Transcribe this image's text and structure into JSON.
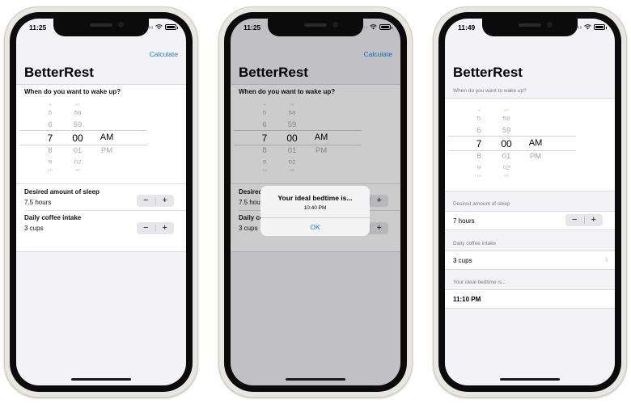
{
  "phones": [
    {
      "status_time": "11:25",
      "nav_button": "Calculate",
      "title": "BetterRest",
      "wake_question": "When do you want to wake up?",
      "picker": {
        "hours": [
          "4",
          "5",
          "6",
          "7",
          "8",
          "9",
          "10"
        ],
        "minutes": [
          "57",
          "58",
          "59",
          "00",
          "01",
          "02",
          "03"
        ],
        "ampm": [
          "AM",
          "PM"
        ]
      },
      "sleep_label": "Desired amount of sleep",
      "sleep_value": "7.5 hours",
      "coffee_label": "Daily coffee intake",
      "coffee_value": "3 cups",
      "stepper_minus": "−",
      "stepper_plus": "+"
    },
    {
      "status_time": "11:25",
      "nav_button": "Calculate",
      "title": "BetterRest",
      "wake_question": "When do you want to wake up?",
      "picker": {
        "hours": [
          "4",
          "5",
          "6",
          "7",
          "8",
          "9",
          "10"
        ],
        "minutes": [
          "57",
          "58",
          "59",
          "00",
          "01",
          "02",
          "03"
        ],
        "ampm": [
          "AM",
          "PM"
        ]
      },
      "sleep_label": "Desired amount of sleep",
      "sleep_value": "7.5 hours",
      "coffee_label": "Daily coffee intake",
      "coffee_value": "3 cups",
      "stepper_minus": "−",
      "stepper_plus": "+",
      "alert": {
        "title": "Your ideal bedtime is...",
        "message": "10:40 PM",
        "button": "OK"
      }
    },
    {
      "status_time": "11:49",
      "title": "BetterRest",
      "wake_question": "When do you want to wake up?",
      "picker": {
        "hours": [
          "4",
          "5",
          "6",
          "7",
          "8",
          "9",
          "10"
        ],
        "minutes": [
          "57",
          "58",
          "59",
          "00",
          "01",
          "02",
          "03"
        ],
        "ampm": [
          "AM",
          "PM"
        ]
      },
      "sleep_header": "Desired amount of sleep",
      "sleep_value": "7 hours",
      "coffee_header": "Daily coffee intake",
      "coffee_value": "3 cups",
      "bedtime_header": "Your ideal bedtime is...",
      "bedtime_value": "11:10 PM",
      "stepper_minus": "−",
      "stepper_plus": "+",
      "chevron": "›"
    }
  ],
  "colors": {
    "accent": "#0a84ff",
    "background": "#f2f2f7",
    "frame": "#e9e7e1"
  },
  "icons": [
    "cellular-signal-icon",
    "wifi-icon",
    "battery-icon",
    "chevron-right-icon"
  ]
}
